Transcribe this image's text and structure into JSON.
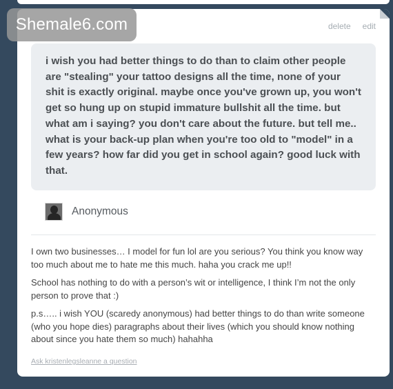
{
  "watermark": "Shemale6.com",
  "controls": {
    "delete": "delete",
    "edit": "edit"
  },
  "question": {
    "text": "i wish you had better things to do than to claim other people are \"stealing\" your tattoo designs all the time, none of your shit is exactly original. maybe once you've grown up, you won't get so hung up on stupid immature bullshit all the time. but what am i saying? you don't care about the future. but tell me.. what is your back-up plan when you're too old to \"model\" in a few years? how far did you get in school again? good luck with that."
  },
  "asker": {
    "name": "Anonymous",
    "avatar_icon": "anonymous-avatar-icon"
  },
  "answer": {
    "paragraphs": [
      "I own two businesses… I model for fun lol are you serious? You think you know way too much about me to hate me this much. haha you crack me up!!",
      "School has nothing to do with a person’s wit or intelligence, I think I’m not the only person to prove that :)",
      "p.s….. i wish YOU (scaredy anonymous) had better things to do than write someone (who you hope dies) paragraphs about their lives (which you should know nothing about since you hate them so much) hahahha"
    ]
  },
  "ask_link": "Ask kristenlegsleanne a question",
  "colors": {
    "dashboard_bg": "#34495e",
    "question_bg": "#ebeef1",
    "link": "#a8adb3"
  }
}
